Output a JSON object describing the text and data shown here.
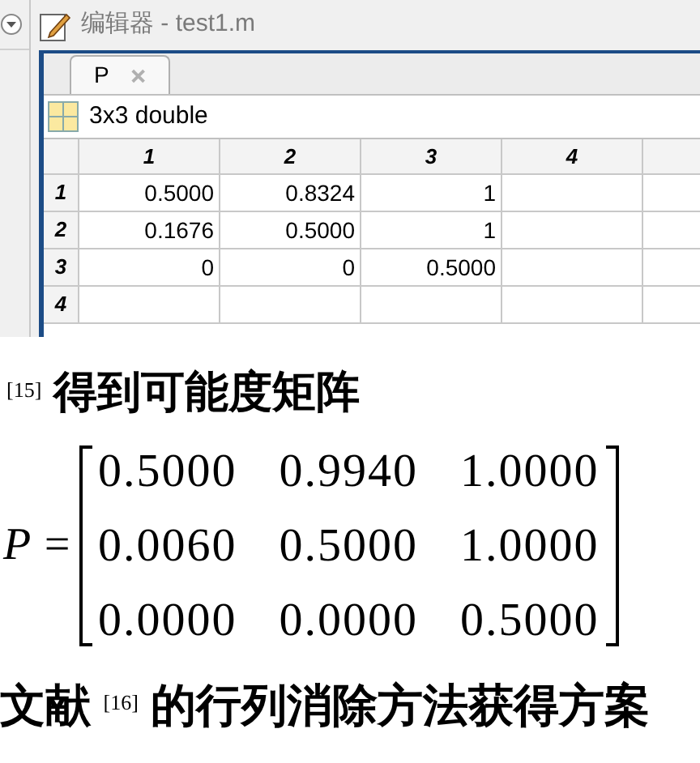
{
  "editor": {
    "title": "编辑器 - test1.m",
    "tabs": [
      {
        "label": "P",
        "selected": true
      }
    ],
    "variable": "3x3 double",
    "table": {
      "columns": [
        "1",
        "2",
        "3",
        "4"
      ],
      "row_headers": [
        "1",
        "2",
        "3",
        "4"
      ],
      "rows": [
        [
          "0.5000",
          "0.8324",
          "1"
        ],
        [
          "0.1676",
          "0.5000",
          "1"
        ],
        [
          "0",
          "0",
          "0.5000"
        ]
      ]
    }
  },
  "document": {
    "heading": "$^{[15]}$ 得到可能度矩阵",
    "equation": {
      "lhs": "P =",
      "matrix": [
        [
          "0.5000",
          "0.9940",
          "1.0000"
        ],
        [
          "0.0060",
          "0.5000",
          "1.0000"
        ],
        [
          "0.0000",
          "0.0000",
          "0.5000"
        ]
      ]
    },
    "closing": "文献 $^{[16]}$ 的行列消除方法获得方案"
  }
}
